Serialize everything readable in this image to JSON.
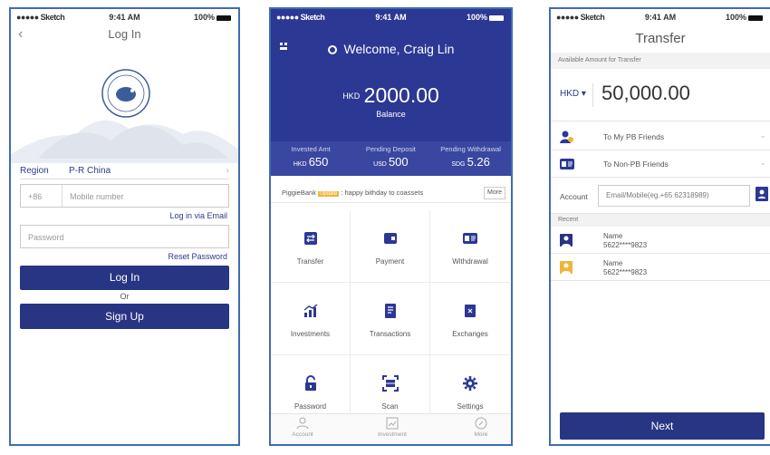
{
  "status_bar": {
    "carrier": "●●●●● Sketch",
    "time": "9:41 AM",
    "battery": "100%"
  },
  "login": {
    "title": "Log In",
    "region_label": "Region",
    "region_value": "P-R China",
    "country_code": "+86",
    "mobile_placeholder": "Mobile number",
    "login_email_link": "Log in via Email",
    "password_placeholder": "Password",
    "reset_link": "Reset Password",
    "login_button": "Log In",
    "or_text": "Or",
    "signup_button": "Sign Up"
  },
  "home": {
    "welcome": "Welcome, Craig Lin",
    "balance_currency": "HKD",
    "balance_amount": "2000.00",
    "balance_label": "Balance",
    "stats": [
      {
        "label": "Invested Amt",
        "currency": "HKD",
        "value": "650"
      },
      {
        "label": "Pending Deposit",
        "currency": "USD",
        "value": "500"
      },
      {
        "label": "Pending Withdrawal",
        "currency": "SDG",
        "value": "5.26"
      }
    ],
    "notice_prefix": "PiggieBank",
    "notice_badge": "Update",
    "notice_text": ": happy bithday to coassets",
    "notice_more": "More",
    "grid": [
      {
        "label": "Transfer",
        "icon": "transfer-icon"
      },
      {
        "label": "Payment",
        "icon": "wallet-icon"
      },
      {
        "label": "Withdrawal",
        "icon": "id-card-icon"
      },
      {
        "label": "Investments",
        "icon": "chart-up-icon"
      },
      {
        "label": "Transactions",
        "icon": "receipt-icon"
      },
      {
        "label": "Exchanges",
        "icon": "exchange-icon"
      },
      {
        "label": "Password",
        "icon": "lock-icon"
      },
      {
        "label": "Scan",
        "icon": "scan-icon"
      },
      {
        "label": "Settings",
        "icon": "gear-icon"
      }
    ],
    "tabs": [
      {
        "label": "Account",
        "icon": "person-icon"
      },
      {
        "label": "Investment",
        "icon": "line-chart-icon"
      },
      {
        "label": "More",
        "icon": "compass-icon"
      }
    ]
  },
  "transfer": {
    "title": "Transfer",
    "available_label": "Available Amount for Transfer",
    "currency": "HKD ▾",
    "amount": "50,000.00",
    "option_pb": "To My PB Friends",
    "option_nonpb": "To Non-PB Friends",
    "account_label": "Account",
    "account_placeholder": "Email/Mobile(eg.+65 62318989)",
    "recent_label": "Recent",
    "recents": [
      {
        "name": "Name",
        "number": "5622****9823",
        "color": "#283583"
      },
      {
        "name": "Name",
        "number": "5622****9823",
        "color": "#f0b43a"
      }
    ],
    "next_button": "Next"
  },
  "colors": {
    "primary": "#283583",
    "header": "#2b3894",
    "accent": "#f0b43a",
    "frame": "#3e6db0"
  }
}
